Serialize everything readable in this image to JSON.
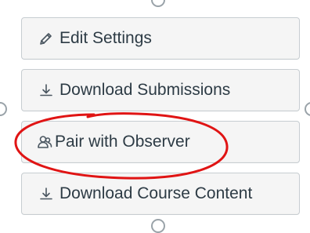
{
  "menu": {
    "items": [
      {
        "label": "Edit Settings",
        "icon": "pencil-icon"
      },
      {
        "label": "Download Submissions",
        "icon": "download-icon"
      },
      {
        "label": "Pair with Observer",
        "icon": "user-pair-icon"
      },
      {
        "label": "Download Course Content",
        "icon": "download-icon"
      }
    ]
  },
  "colors": {
    "button_bg": "#f5f5f5",
    "button_border": "#c7cdd1",
    "text": "#2d3b45",
    "annotation": "#e01414"
  }
}
